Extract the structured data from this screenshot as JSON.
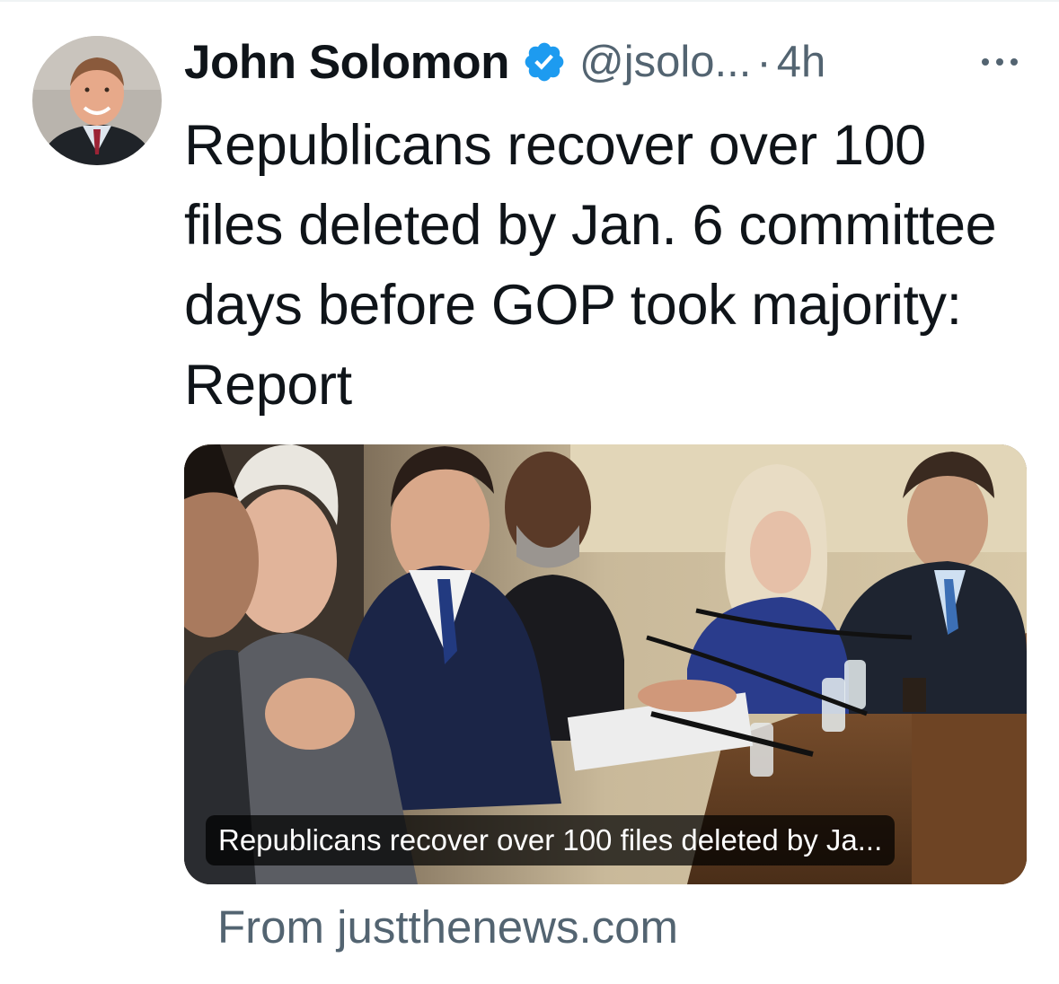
{
  "tweet": {
    "display_name": "John Solomon",
    "handle": "@jsolo...",
    "separator": "·",
    "time": "4h",
    "verified": true,
    "text": "Republicans recover over 100 files deleted by Jan. 6 committee days before GOP took majority: Report"
  },
  "card": {
    "caption": "Republicans recover over 100 files deleted by Ja...",
    "source": "From justthenews.com"
  },
  "icons": {
    "verified": "verified-badge-icon",
    "more": "more-options-icon"
  },
  "colors": {
    "text_primary": "#0f1419",
    "text_secondary": "#536471",
    "verified_blue": "#1d9bf0"
  }
}
